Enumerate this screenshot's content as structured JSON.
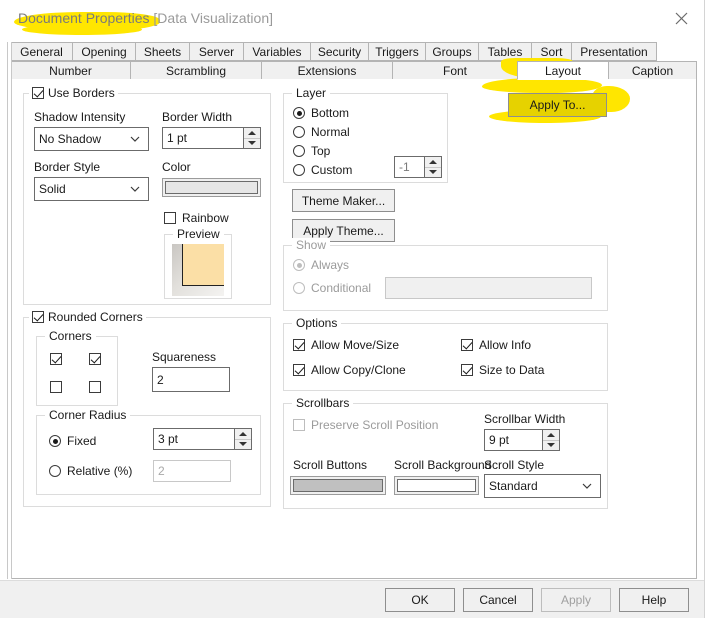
{
  "window": {
    "title": "Document Properties",
    "document_name": "[Data Visualization]",
    "close_icon": "close-icon"
  },
  "tabs": {
    "row1": [
      {
        "label": "General",
        "selected": false
      },
      {
        "label": "Opening",
        "selected": false
      },
      {
        "label": "Sheets",
        "selected": false
      },
      {
        "label": "Server",
        "selected": false
      },
      {
        "label": "Variables",
        "selected": false
      },
      {
        "label": "Security",
        "selected": false
      },
      {
        "label": "Triggers",
        "selected": false
      },
      {
        "label": "Groups",
        "selected": false
      },
      {
        "label": "Tables",
        "selected": false
      },
      {
        "label": "Sort",
        "selected": false
      },
      {
        "label": "Presentation",
        "selected": false
      }
    ],
    "row2": [
      {
        "label": "Number",
        "selected": false
      },
      {
        "label": "Scrambling",
        "selected": false
      },
      {
        "label": "Extensions",
        "selected": false
      },
      {
        "label": "Font",
        "selected": false
      },
      {
        "label": "Layout",
        "selected": true
      },
      {
        "label": "Caption",
        "selected": false
      }
    ]
  },
  "apply_to": {
    "label": "Apply To..."
  },
  "borders": {
    "group_label": "Use Borders",
    "group_checked": true,
    "shadow_intensity_label": "Shadow Intensity",
    "shadow_intensity_value": "No Shadow",
    "border_width_label": "Border Width",
    "border_width_value": "1 pt",
    "border_style_label": "Border Style",
    "border_style_value": "Solid",
    "color_label": "Color",
    "color_value": "#e6e6e6",
    "rainbow_label": "Rainbow",
    "rainbow_checked": false,
    "preview_label": "Preview",
    "preview_fill": "#fbdfa6"
  },
  "rounded": {
    "group_label": "Rounded Corners",
    "group_checked": true,
    "corners_label": "Corners",
    "corners": [
      {
        "name": "top-left",
        "checked": true
      },
      {
        "name": "top-right",
        "checked": true
      },
      {
        "name": "bottom-left",
        "checked": false
      },
      {
        "name": "bottom-right",
        "checked": false
      }
    ],
    "squareness_label": "Squareness",
    "squareness_value": "2",
    "radius_group_label": "Corner Radius",
    "fixed_label": "Fixed",
    "fixed_selected": true,
    "fixed_value": "3 pt",
    "relative_label": "Relative (%)",
    "relative_selected": false,
    "relative_value": "2"
  },
  "layer": {
    "group_label": "Layer",
    "options": [
      {
        "label": "Bottom",
        "selected": true
      },
      {
        "label": "Normal",
        "selected": false
      },
      {
        "label": "Top",
        "selected": false
      },
      {
        "label": "Custom",
        "selected": false
      }
    ],
    "custom_value": "-1"
  },
  "theme": {
    "theme_maker_label": "Theme Maker...",
    "apply_theme_label": "Apply Theme..."
  },
  "show": {
    "group_label": "Show",
    "always_label": "Always",
    "always_selected": true,
    "conditional_label": "Conditional",
    "conditional_selected": false,
    "conditional_value": "",
    "disabled": true
  },
  "options": {
    "group_label": "Options",
    "items": [
      {
        "label": "Allow Move/Size",
        "checked": true
      },
      {
        "label": "Allow Info",
        "checked": true
      },
      {
        "label": "Allow Copy/Clone",
        "checked": true
      },
      {
        "label": "Size to Data",
        "checked": true
      }
    ]
  },
  "scrollbars": {
    "group_label": "Scrollbars",
    "preserve_label": "Preserve Scroll Position",
    "preserve_checked": false,
    "preserve_disabled": true,
    "width_label": "Scrollbar Width",
    "width_value": "9 pt",
    "scroll_buttons_label": "Scroll Buttons",
    "scroll_buttons_color": "#c0c0c0",
    "scroll_background_label": "Scroll Background",
    "scroll_background_color": "#ffffff",
    "scroll_style_label": "Scroll Style",
    "scroll_style_value": "Standard"
  },
  "footer": {
    "ok_label": "OK",
    "cancel_label": "Cancel",
    "apply_label": "Apply",
    "apply_enabled": false,
    "help_label": "Help"
  },
  "colors": {
    "highlight": "#ffe600",
    "dialog_bg": "#ffffff",
    "footer_bg": "#f0f0f0"
  }
}
